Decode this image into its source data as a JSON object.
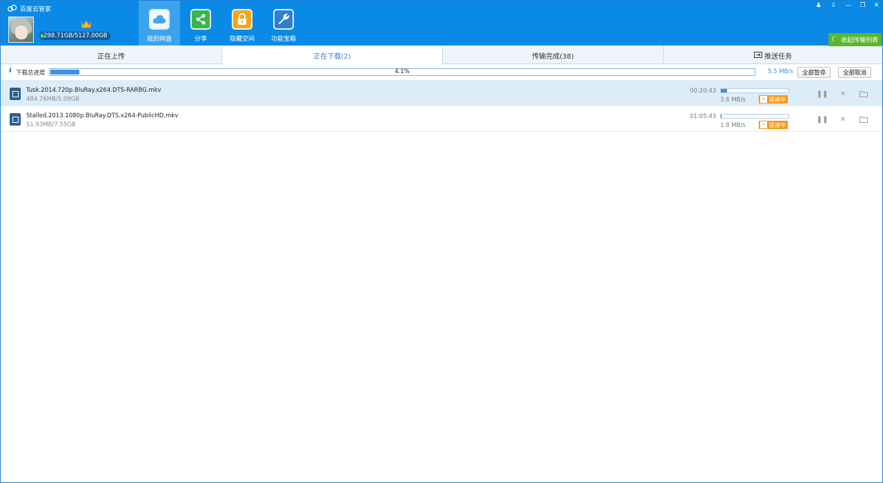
{
  "app": {
    "title": "百度云管家",
    "quota": "298.71GB/5127.00GB"
  },
  "nav": [
    {
      "label": "我的网盘",
      "icon": "cloud-icon"
    },
    {
      "label": "分享",
      "icon": "share-icon"
    },
    {
      "label": "隐藏空间",
      "icon": "lock-icon"
    },
    {
      "label": "功能宝箱",
      "icon": "wrench-icon"
    }
  ],
  "window_controls": {
    "notify": "♟",
    "menu": "⇩",
    "minimize": "—",
    "restore": "❐",
    "close": "✕"
  },
  "collapse_label": "收起传输列表",
  "tabs": [
    {
      "label": "正在上传"
    },
    {
      "label": "正在下载(2)"
    },
    {
      "label": "传输完成(38)"
    },
    {
      "label": "推送任务"
    }
  ],
  "overall": {
    "label": "下载总进度",
    "percent_text": "4.1%",
    "progress": 0.041,
    "speed": "5.5 MB/s",
    "pause_all": "全部暂停",
    "cancel_all": "全部取消"
  },
  "downloads": [
    {
      "name": "Tusk.2014.720p.BluRay.x264.DTS-RARBG.mkv",
      "size": "484.76MB/5.09GB",
      "eta": "00:20:43",
      "progress": 0.093,
      "speed": "3.6 MB/s",
      "accel": "提速中"
    },
    {
      "name": "Stalled.2013.1080p.BluRay.DTS.x264-PublicHD.mkv",
      "size": "51.93MB/7.55GB",
      "eta": "01:05:43",
      "progress": 0.007,
      "speed": "1.8 MB/s",
      "accel": "提速中"
    }
  ],
  "colors": {
    "header": "#0a8ae6",
    "progress": "#3c92dc",
    "accel": "#f39a1e",
    "collapse": "#5cb52e"
  }
}
